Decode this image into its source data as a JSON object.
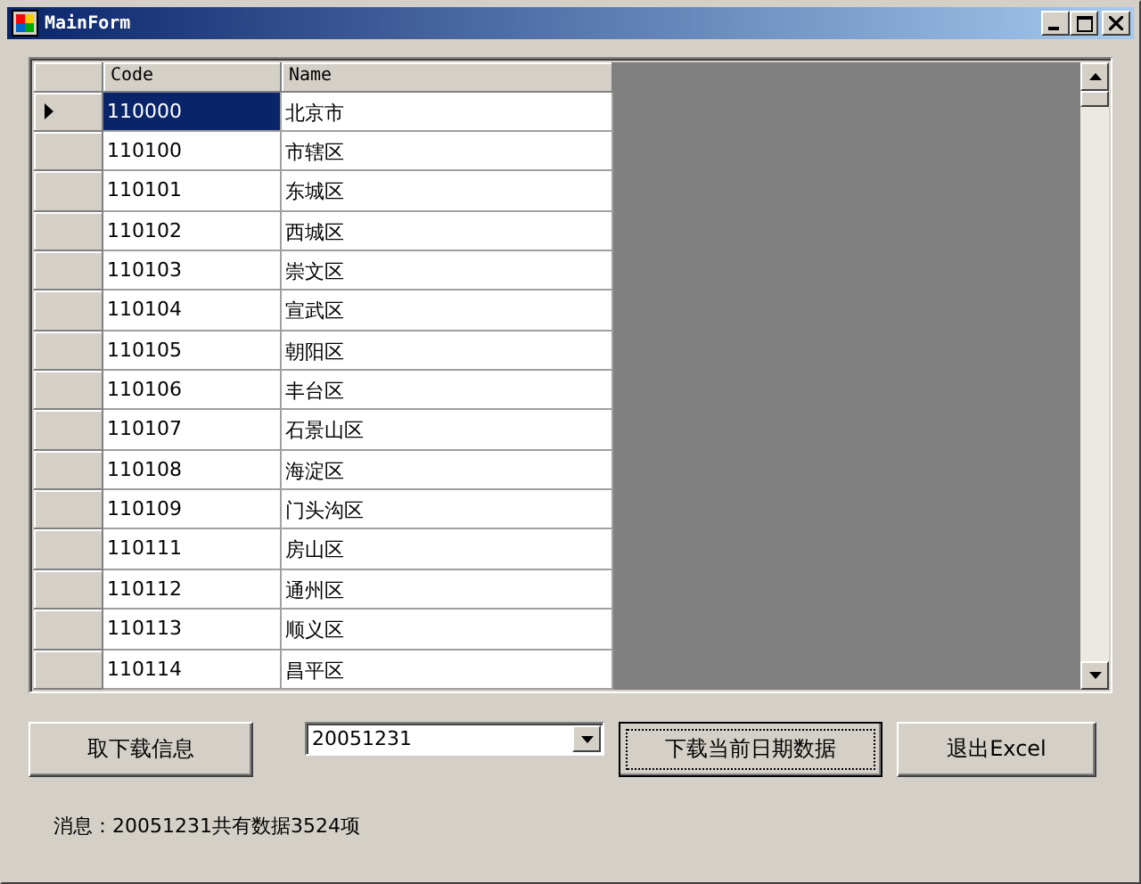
{
  "window": {
    "title": "MainForm"
  },
  "grid": {
    "columns": [
      "Code",
      "Name"
    ],
    "rows": [
      {
        "code": "110000",
        "name": "北京市",
        "selected": true
      },
      {
        "code": "110100",
        "name": "市辖区",
        "selected": false
      },
      {
        "code": "110101",
        "name": "东城区",
        "selected": false
      },
      {
        "code": "110102",
        "name": "西城区",
        "selected": false
      },
      {
        "code": "110103",
        "name": "崇文区",
        "selected": false
      },
      {
        "code": "110104",
        "name": "宣武区",
        "selected": false
      },
      {
        "code": "110105",
        "name": "朝阳区",
        "selected": false
      },
      {
        "code": "110106",
        "name": "丰台区",
        "selected": false
      },
      {
        "code": "110107",
        "name": "石景山区",
        "selected": false
      },
      {
        "code": "110108",
        "name": "海淀区",
        "selected": false
      },
      {
        "code": "110109",
        "name": "门头沟区",
        "selected": false
      },
      {
        "code": "110111",
        "name": "房山区",
        "selected": false
      },
      {
        "code": "110112",
        "name": "通州区",
        "selected": false
      },
      {
        "code": "110113",
        "name": "顺义区",
        "selected": false
      },
      {
        "code": "110114",
        "name": "昌平区",
        "selected": false
      }
    ]
  },
  "controls": {
    "fetch_button": "取下载信息",
    "date": {
      "value": "20051231"
    },
    "download_button": {
      "label": "下载当前日期数据",
      "focused": true
    },
    "exit_button": "退出Excel"
  },
  "status": "消息：20051231共有数据3524项"
}
